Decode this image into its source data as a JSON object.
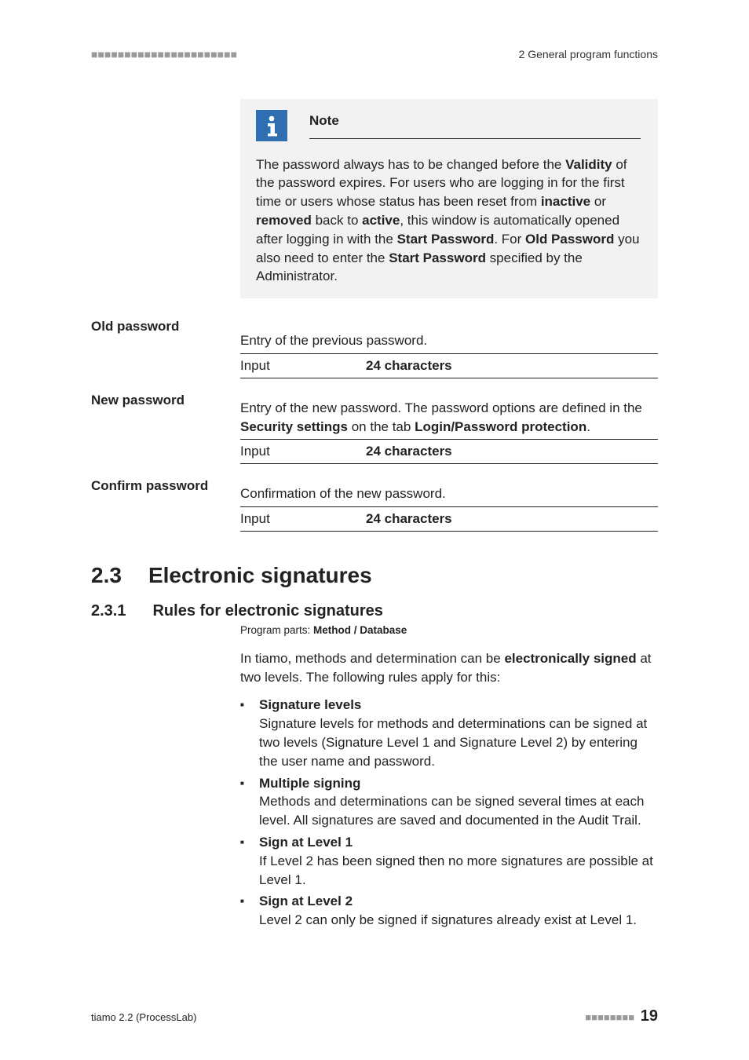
{
  "header": {
    "left": "■■■■■■■■■■■■■■■■■■■■■■",
    "right": "2 General program functions"
  },
  "note": {
    "title": "Note",
    "body_parts": [
      "The password always has to be changed before the ",
      "Validity",
      " of the password expires. For users who are logging in for the first time or users whose status has been reset from ",
      "inactive",
      " or ",
      "removed",
      " back to ",
      "active",
      ", this window is automatically opened after logging in with the ",
      "Start Password",
      ". For ",
      "Old Password",
      " you also need to enter the ",
      "Start Password",
      " specified by the Administrator."
    ]
  },
  "fields": {
    "old": {
      "label": "Old password",
      "desc": "Entry of the previous password.",
      "input_label": "Input",
      "input_value": "24 characters"
    },
    "new": {
      "label": "New password",
      "desc_parts": [
        "Entry of the new password. The password options are defined in the ",
        "Security settings",
        " on the tab ",
        "Login/Password protection",
        "."
      ],
      "input_label": "Input",
      "input_value": "24 characters"
    },
    "confirm": {
      "label": "Confirm password",
      "desc": "Confirmation of the new password.",
      "input_label": "Input",
      "input_value": "24 characters"
    }
  },
  "h1": {
    "num": "2.3",
    "text": "Electronic signatures"
  },
  "h2": {
    "num": "2.3.1",
    "text": "Rules for electronic signatures"
  },
  "program_parts": {
    "prefix": "Program parts: ",
    "value": "Method / Database"
  },
  "intro_parts": [
    "In tiamo, methods and determination can be ",
    "electronically signed",
    " at two levels. The following rules apply for this:"
  ],
  "bullets": [
    {
      "head": "Signature levels",
      "body": "Signature levels for methods and determinations can be signed at two levels (Signature Level 1 and Signature Level 2) by entering the user name and password."
    },
    {
      "head": "Multiple signing",
      "body": "Methods and determinations can be signed several times at each level. All signatures are saved and documented in the Audit Trail."
    },
    {
      "head": "Sign at Level 1",
      "body": "If Level 2 has been signed then no more signatures are possible at Level 1."
    },
    {
      "head": "Sign at Level 2",
      "body": "Level 2 can only be signed if signatures already exist at Level 1."
    }
  ],
  "footer": {
    "left": "tiamo 2.2 (ProcessLab)",
    "bars": "■■■■■■■■",
    "page": "19"
  }
}
